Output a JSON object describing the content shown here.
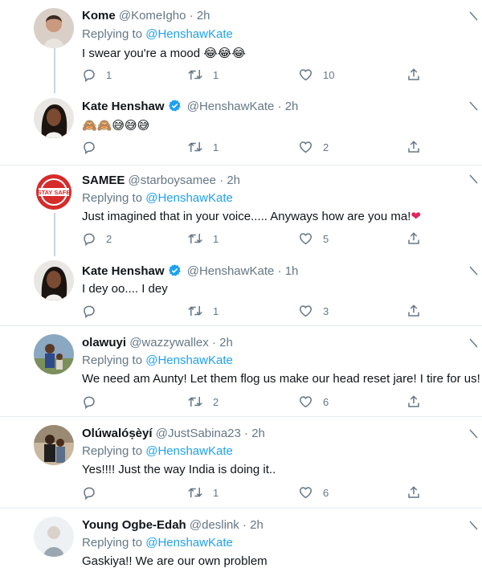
{
  "reply_prefix": "Replying to ",
  "tweets": [
    {
      "name": "Kome",
      "handle": "@KomeIgho",
      "time": "2h",
      "replying_to": "@HenshawKate",
      "text": "I swear you're a mood",
      "emoji": [
        "laughing-tears",
        "laughing-tears",
        "laughing-tears"
      ],
      "replies": "1",
      "retweets": "1",
      "likes": "10",
      "verified": false
    },
    {
      "name": "Kate Henshaw",
      "handle": "@HenshawKate",
      "time": "2h",
      "replying_to": "",
      "text": "",
      "emoji": [
        "see-no-evil-monkey",
        "see-no-evil-monkey",
        "grinning-sweat",
        "grinning-sweat",
        "grinning-sweat"
      ],
      "replies": "",
      "retweets": "1",
      "likes": "2",
      "verified": true
    },
    {
      "name": "SAMEE",
      "handle": "@starboysamee",
      "time": "2h",
      "replying_to": "@HenshawKate",
      "text": "Just imagined that in your voice..... Anyways how are you ma!",
      "emoji": [
        "red-heart"
      ],
      "avatar_text": "STAY SAFE",
      "replies": "2",
      "retweets": "1",
      "likes": "5",
      "verified": false
    },
    {
      "name": "Kate Henshaw",
      "handle": "@HenshawKate",
      "time": "1h",
      "replying_to": "",
      "text": "I dey oo.... I dey",
      "emoji": [],
      "replies": "",
      "retweets": "1",
      "likes": "3",
      "verified": true
    },
    {
      "name": "olawuyi",
      "handle": "@wazzywallex",
      "time": "2h",
      "replying_to": "@HenshawKate",
      "text": "We need am Aunty! Let them flog us make our head reset jare! I tire for us!",
      "emoji": [],
      "replies": "",
      "retweets": "2",
      "likes": "6",
      "verified": false
    },
    {
      "name": "Olúwalóṣèyí",
      "handle": "@JustSabina23",
      "time": "2h",
      "replying_to": "@HenshawKate",
      "text": "Yes!!!! Just the way India is doing it..",
      "emoji": [],
      "replies": "",
      "retweets": "1",
      "likes": "6",
      "verified": false
    },
    {
      "name": "Young Ogbe-Edah",
      "handle": "@deslink",
      "time": "2h",
      "replying_to": "@HenshawKate",
      "text": "Gaskiya!! We are our own problem",
      "emoji": [],
      "replies": "",
      "retweets": "",
      "likes": "",
      "verified": false
    }
  ],
  "colors": {
    "accent": "#1da1f2",
    "secondary_text": "#657786",
    "divider": "#e6ecf0",
    "thread_line": "#ccd6dd"
  },
  "icons": {
    "reply": "reply-icon",
    "retweet": "retweet-icon",
    "like": "like-icon",
    "share": "share-icon",
    "more": "more-icon",
    "verified": "verified-badge-icon"
  }
}
